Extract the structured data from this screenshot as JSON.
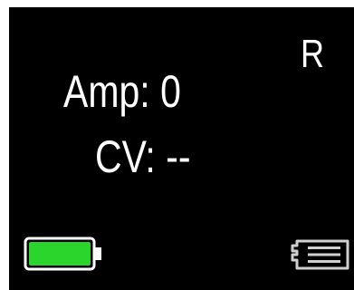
{
  "display": {
    "mode_indicator": "R",
    "amp_text": "Amp: 0",
    "cv_text": "CV: --"
  },
  "status": {
    "battery_icon": "battery-full-icon",
    "battery_level": 1.0,
    "storage_icon": "sd-card-icon"
  },
  "colors": {
    "background": "#000000",
    "text": "#ffffff",
    "battery_fill": "#2bd52b",
    "storage_icon": "#d0d0d0"
  }
}
